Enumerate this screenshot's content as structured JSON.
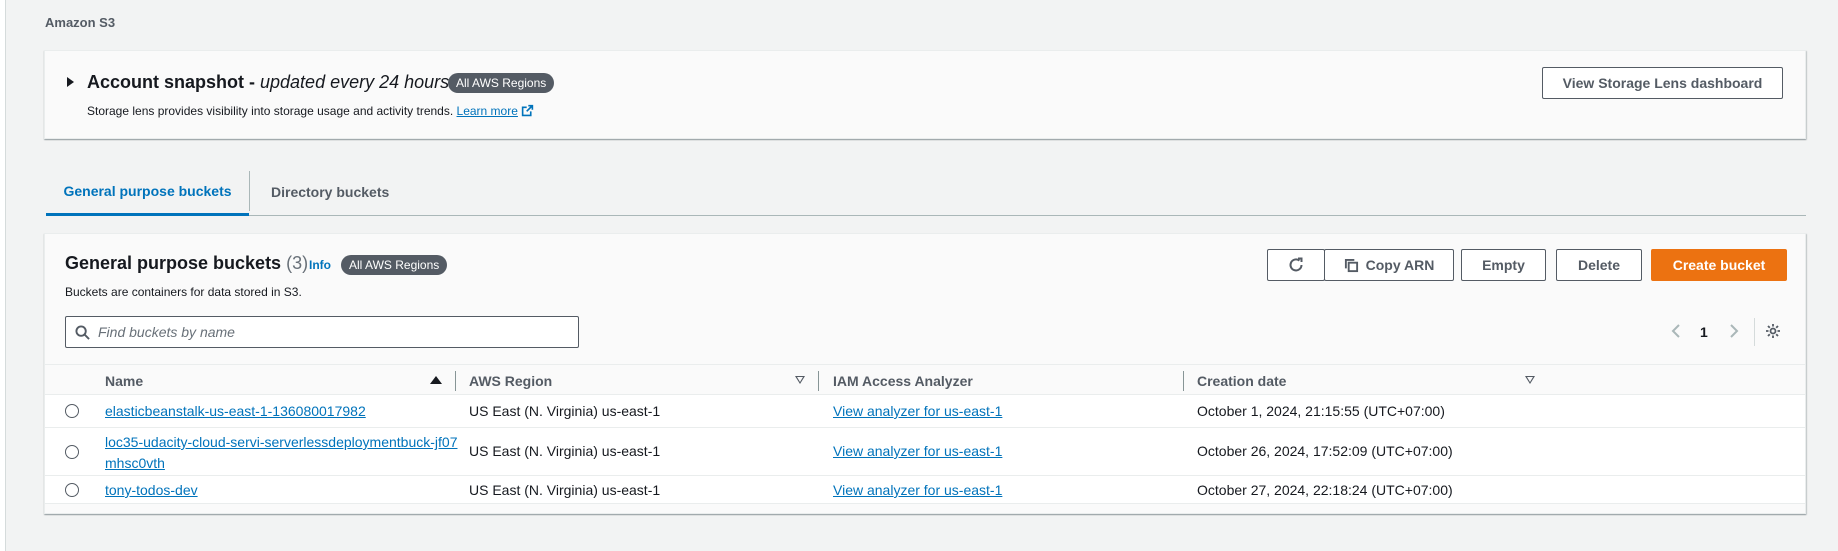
{
  "breadcrumb": "Amazon S3",
  "snapshot": {
    "title": "Account snapshot - ",
    "subtitle": "updated every 24 hours",
    "badge": "All AWS Regions",
    "description": "Storage lens provides visibility into storage usage and activity trends. ",
    "learn_more": "Learn more",
    "button": "View Storage Lens dashboard"
  },
  "tabs": [
    {
      "label": "General purpose buckets",
      "active": true
    },
    {
      "label": "Directory buckets",
      "active": false
    }
  ],
  "buckets": {
    "title": "General purpose buckets",
    "count": "(3)",
    "info": "Info",
    "badge": "All AWS Regions",
    "description": "Buckets are containers for data stored in S3.",
    "buttons": {
      "copy_arn": "Copy ARN",
      "empty": "Empty",
      "delete": "Delete",
      "create": "Create bucket"
    },
    "search_placeholder": "Find buckets by name",
    "page": "1",
    "columns": [
      "Name",
      "AWS Region",
      "IAM Access Analyzer",
      "Creation date"
    ],
    "rows": [
      {
        "name": "elasticbeanstalk-us-east-1-136080017982",
        "region": "US East (N. Virginia) us-east-1",
        "analyzer": "View analyzer for us-east-1",
        "created": "October 1, 2024, 21:15:55 (UTC+07:00)"
      },
      {
        "name": "loc35-udacity-cloud-servi-serverlessdeploymentbuck-jf07mhsc0vth",
        "region": "US East (N. Virginia) us-east-1",
        "analyzer": "View analyzer for us-east-1",
        "created": "October 26, 2024, 17:52:09 (UTC+07:00)"
      },
      {
        "name": "tony-todos-dev",
        "region": "US East (N. Virginia) us-east-1",
        "analyzer": "View analyzer for us-east-1",
        "created": "October 27, 2024, 22:18:24 (UTC+07:00)"
      }
    ]
  },
  "colors": {
    "link": "#0073bb",
    "primary_button": "#ec7211",
    "badge": "#545b64"
  }
}
